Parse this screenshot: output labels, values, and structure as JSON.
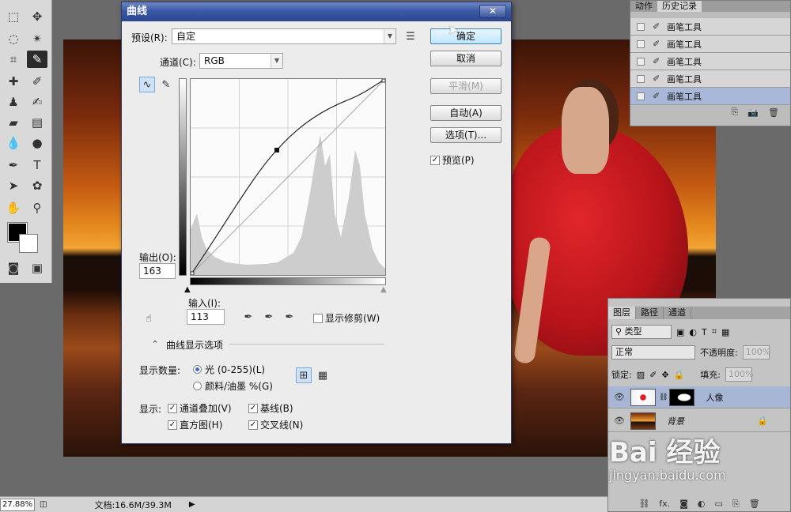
{
  "status": {
    "zoom": "27.88%",
    "doc_size": "文档:16.6M/39.3M"
  },
  "history": {
    "tabs": [
      "动作",
      "历史记录"
    ],
    "items": [
      "画笔工具",
      "画笔工具",
      "画笔工具",
      "画笔工具",
      "画笔工具"
    ],
    "selected_index": 4
  },
  "layers": {
    "tabs": [
      "图层",
      "路径",
      "通道"
    ],
    "filter": "类型",
    "blend_mode": "正常",
    "opacity_label": "不透明度:",
    "opacity_value": "100%",
    "lock_label": "锁定:",
    "fill_label": "填充:",
    "fill_value": "100%",
    "items": [
      {
        "name": "人像"
      },
      {
        "name": "背景"
      }
    ]
  },
  "watermark": {
    "logo": "Bai 经验",
    "url": "jingyan.baidu.com"
  },
  "curves": {
    "title": "曲线",
    "close": "✕",
    "preset_label": "预设(R):",
    "preset_value": "自定",
    "channel_label": "通道(C):",
    "channel_value": "RGB",
    "output_label": "输出(O):",
    "output_value": "163",
    "input_label": "输入(I):",
    "input_value": "113",
    "show_clipping": "显示修剪(W)",
    "buttons": {
      "ok": "确定",
      "cancel": "取消",
      "smooth": "平滑(M)",
      "auto": "自动(A)",
      "options": "选项(T)..."
    },
    "preview": "预览(P)",
    "display_options": "曲线显示选项",
    "show_amount_label": "显示数量:",
    "light": "光 (0-255)(L)",
    "pigment": "颜料/油墨 %(G)",
    "show_label": "显示:",
    "channel_overlay": "通道叠加(V)",
    "baseline": "基线(B)",
    "histogram": "直方图(H)",
    "intersection": "交叉线(N)"
  }
}
